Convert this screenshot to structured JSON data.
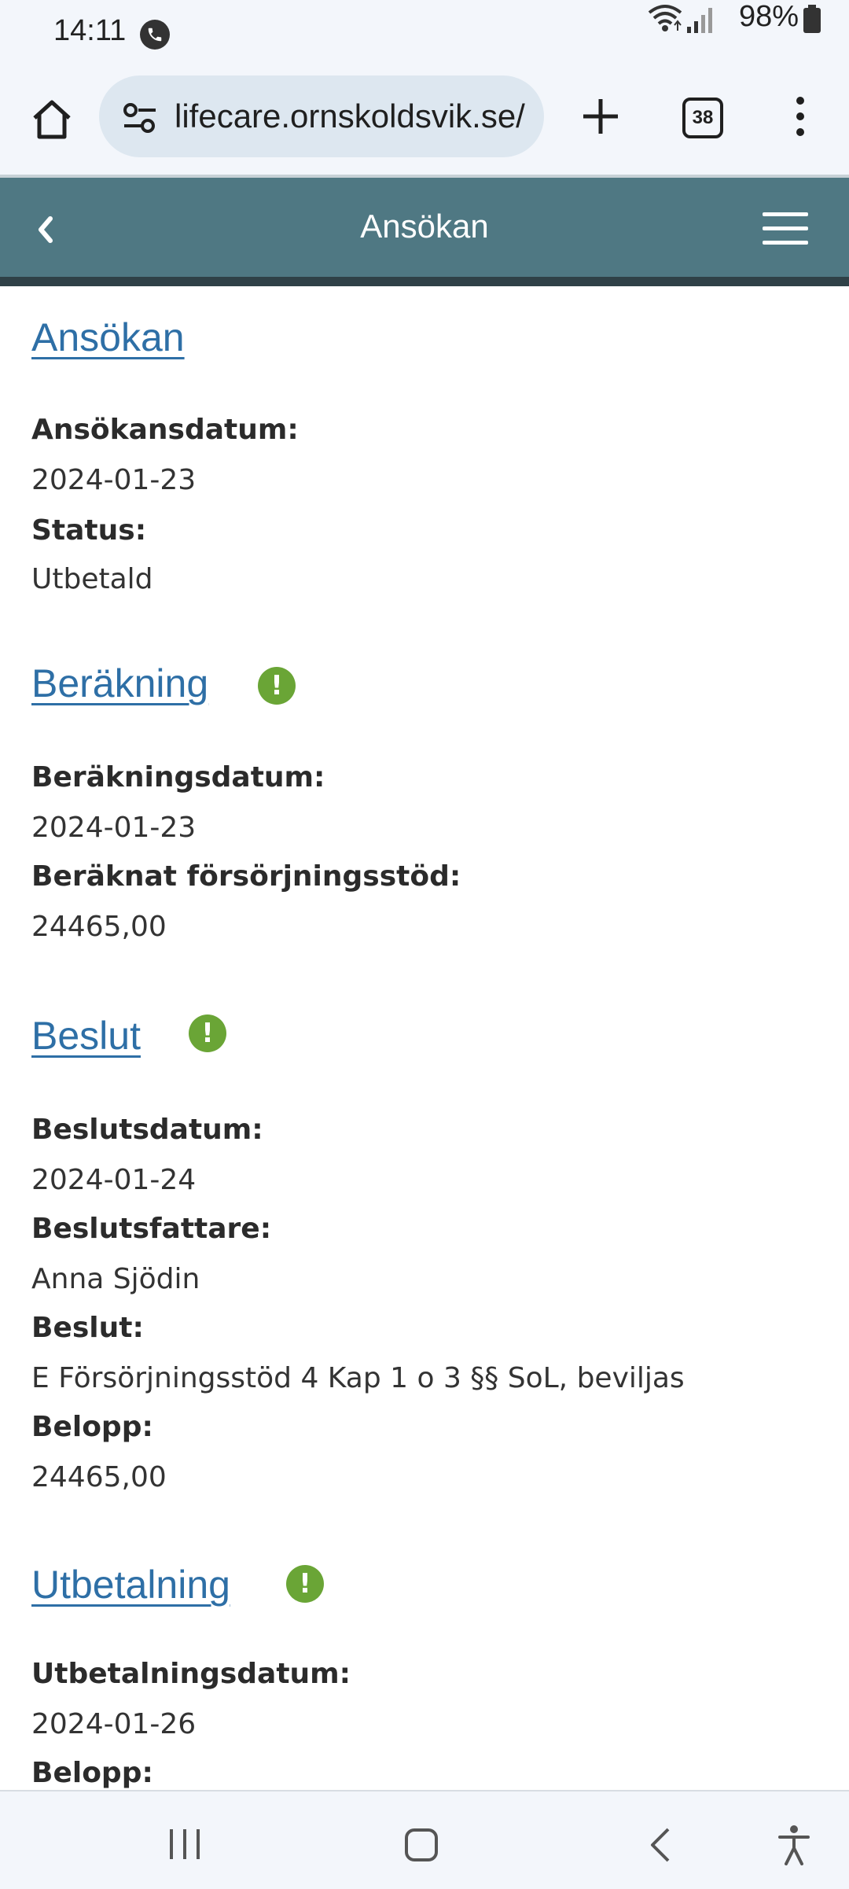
{
  "status_bar": {
    "time": "14:11",
    "battery": "98%"
  },
  "browser": {
    "url": "lifecare.ornskoldsvik.se/",
    "tab_count": "38"
  },
  "header": {
    "title": "Ansökan"
  },
  "sections": {
    "ansokan": {
      "title": "Ansökan",
      "fields": [
        {
          "label": "Ansökansdatum:",
          "value": "2024-01-23"
        },
        {
          "label": "Status:",
          "value": "Utbetald"
        }
      ]
    },
    "berakning": {
      "title": "Beräkning",
      "fields": [
        {
          "label": "Beräkningsdatum:",
          "value": "2024-01-23"
        },
        {
          "label": "Beräknat försörjningsstöd:",
          "value": "24465,00"
        }
      ]
    },
    "beslut": {
      "title": "Beslut",
      "fields": [
        {
          "label": "Beslutsdatum:",
          "value": "2024-01-24"
        },
        {
          "label": "Beslutsfattare:",
          "value": "Anna Sjödin"
        },
        {
          "label": "Beslut:",
          "value": "E Försörjningsstöd 4 Kap 1 o 3 §§ SoL, beviljas"
        },
        {
          "label": "Belopp:",
          "value": "24465,00"
        }
      ]
    },
    "utbetalning": {
      "title": "Utbetalning",
      "fields": [
        {
          "label": "Utbetalningsdatum:",
          "value": "2024-01-26"
        },
        {
          "label": "Belopp:",
          "value": ""
        }
      ]
    }
  },
  "alert_symbol": "!",
  "colors": {
    "header_bg": "#4f7883",
    "link": "#2e6fa6",
    "alert_icon": "#6aa536"
  },
  "icons": [
    "phone-call-icon",
    "wifi-icon",
    "signal-icon",
    "battery-icon",
    "home-icon",
    "tune-icon",
    "plus-icon",
    "tabs-icon",
    "more-vert-icon",
    "back-chevron-icon",
    "hamburger-menu-icon",
    "alert-icon",
    "nav-recents-icon",
    "nav-home-icon",
    "nav-back-icon",
    "accessibility-icon"
  ]
}
